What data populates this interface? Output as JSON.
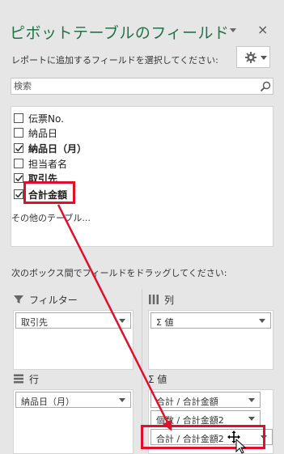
{
  "pane": {
    "title": "ピボットテーブルのフィールド",
    "subtitle": "レポートに追加するフィールドを選択してください:",
    "close_glyph": "×"
  },
  "search": {
    "placeholder": "検索"
  },
  "fields": [
    {
      "label": "伝票No.",
      "checked": false,
      "bold": false
    },
    {
      "label": "納品日",
      "checked": false,
      "bold": false
    },
    {
      "label": "納品日（月）",
      "checked": true,
      "bold": true
    },
    {
      "label": "担当者名",
      "checked": false,
      "bold": false
    },
    {
      "label": "取引先",
      "checked": true,
      "bold": true
    },
    {
      "label": "合計金額",
      "checked": true,
      "bold": true
    }
  ],
  "more_tables": "その他のテーブル...",
  "drag_hint": "次のボックス間でフィールドをドラッグしてください:",
  "areas": {
    "filter": {
      "label": "フィルター",
      "items": [
        "取引先"
      ]
    },
    "columns": {
      "label": "列",
      "items": [
        "Σ 値"
      ]
    },
    "rows": {
      "label": "行",
      "items": [
        "納品日（月）"
      ]
    },
    "values": {
      "label": "Σ 値",
      "items": [
        "合計 / 合計金額",
        "個数 / 合計金額2",
        "合計 / 合計金額2"
      ]
    }
  },
  "colors": {
    "accent": "#217346",
    "highlight": "#e0102a"
  },
  "icons": [
    "dropdown-icon",
    "close-icon",
    "gear-icon",
    "search-icon",
    "filter-icon",
    "columns-icon",
    "rows-icon",
    "sigma-icon",
    "move-cursor-icon",
    "pointer-cursor-icon"
  ]
}
